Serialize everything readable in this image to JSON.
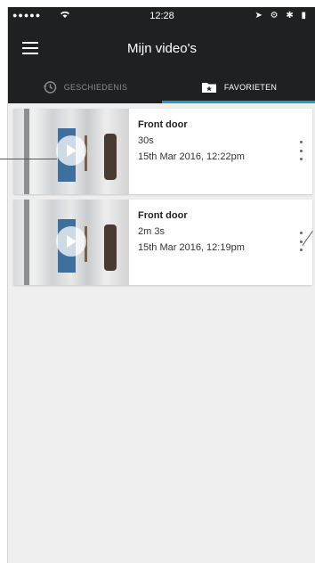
{
  "statusbar": {
    "signal": "●●●●●",
    "wifi": "wifi-icon",
    "time": "12:28",
    "right": "➤ ⚙ ✱ ▮"
  },
  "navbar": {
    "title": "Mijn video's"
  },
  "tabs": [
    {
      "label": "GESCHIEDENIS",
      "icon": "history-icon",
      "active": false
    },
    {
      "label": "FAVORIETEN",
      "icon": "folder-star-icon",
      "active": true
    }
  ],
  "videos": [
    {
      "title": "Front door",
      "duration": "30s",
      "date": "15th Mar 2016, 12:22pm"
    },
    {
      "title": "Front door",
      "duration": "2m 3s",
      "date": "15th Mar 2016, 12:19pm"
    }
  ],
  "colors": {
    "bar": "#1f2021",
    "accent": "#1c9ad6",
    "background": "#efefef"
  }
}
